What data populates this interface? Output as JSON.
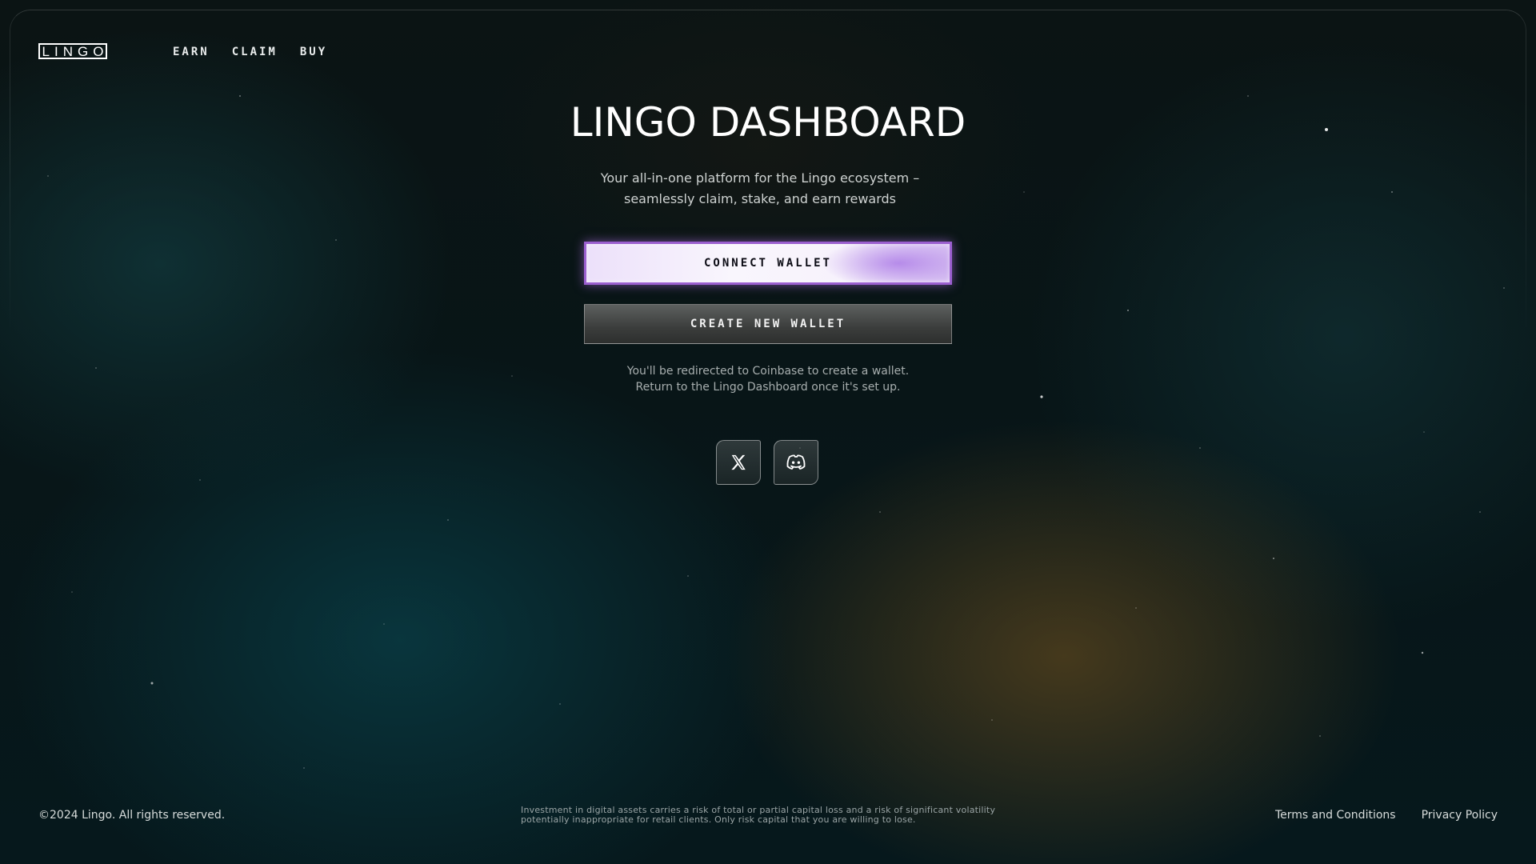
{
  "brand": {
    "logo_text": "LINGO"
  },
  "nav": {
    "items": [
      {
        "label": "EARN"
      },
      {
        "label": "CLAIM"
      },
      {
        "label": "BUY"
      }
    ]
  },
  "main": {
    "title": "LINGO DASHBOARD",
    "subtitle": "Your all-in-one platform for the Lingo ecosystem – seamlessly claim, stake, and earn rewards",
    "connect_wallet_label": "CONNECT WALLET",
    "create_wallet_label": "CREATE NEW WALLET",
    "note_line1": "You'll be redirected to Coinbase to create a wallet.",
    "note_line2": "Return to the Lingo Dashboard once it's set up."
  },
  "socials": [
    {
      "icon": "x-twitter-icon"
    },
    {
      "icon": "discord-icon"
    }
  ],
  "footer": {
    "copyright": "©2024 Lingo. All rights reserved.",
    "disclaimer": "Investment in digital assets carries a risk of total or partial capital loss and a risk of significant volatility potentially inappropriate for retail clients. Only risk capital that you are willing to lose.",
    "terms_label": "Terms and Conditions",
    "privacy_label": "Privacy Policy"
  },
  "colors": {
    "accent_purple": "#9b5fcf",
    "background": "#050a0c"
  }
}
